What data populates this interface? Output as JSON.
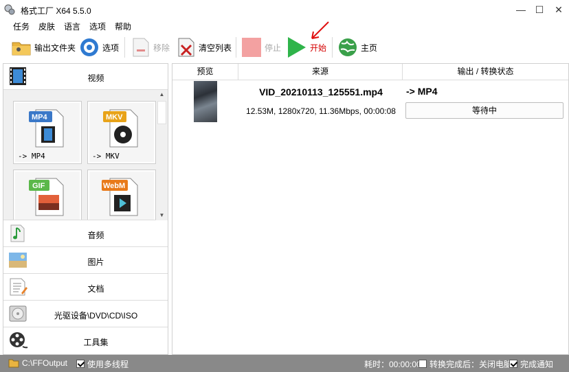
{
  "window": {
    "title": "格式工厂 X64 5.5.0",
    "controls": {
      "minimize": "—",
      "maximize": "☐",
      "close": "✕"
    }
  },
  "menu": [
    "任务",
    "皮肤",
    "语言",
    "选项",
    "帮助"
  ],
  "toolbar": {
    "output_folder": "输出文件夹",
    "options": "选项",
    "remove": "移除",
    "clear_list": "清空列表",
    "stop": "停止",
    "start": "开始",
    "home": "主页"
  },
  "categories": {
    "video": "视频",
    "audio": "音频",
    "image": "图片",
    "document": "文档",
    "optical": "光驱设备\\DVD\\CD\\ISO",
    "tools": "工具集"
  },
  "video_formats": [
    {
      "badge": "MP4",
      "label": "-> MP4",
      "badge_color": "#3a78c8"
    },
    {
      "badge": "MKV",
      "label": "-> MKV",
      "badge_color": "#e8a319"
    },
    {
      "badge": "GIF",
      "label": "",
      "badge_color": "#5bb84a"
    },
    {
      "badge": "WebM",
      "label": "",
      "badge_color": "#e87a1a"
    }
  ],
  "task_table": {
    "headers": [
      "预览",
      "来源",
      "输出 / 转换状态"
    ],
    "rows": [
      {
        "file_name": "VID_20210113_125551.mp4",
        "file_info": "12.53M, 1280x720, 11.36Mbps, 00:00:08",
        "output_format": "-> MP4",
        "status": "等待中"
      }
    ]
  },
  "statusbar": {
    "output_path": "C:\\FFOutput",
    "multithread_label": "使用多线程",
    "multithread_checked": true,
    "elapsed": "耗时：00:00:00",
    "after_done_label": "转换完成后：关闭电脑",
    "after_done_checked": false,
    "notify_label": "完成通知",
    "notify_checked": true
  },
  "colors": {
    "statusbar_bg": "#898989",
    "start_label": "#d40000",
    "disabled_label": "#a9a9a9"
  }
}
